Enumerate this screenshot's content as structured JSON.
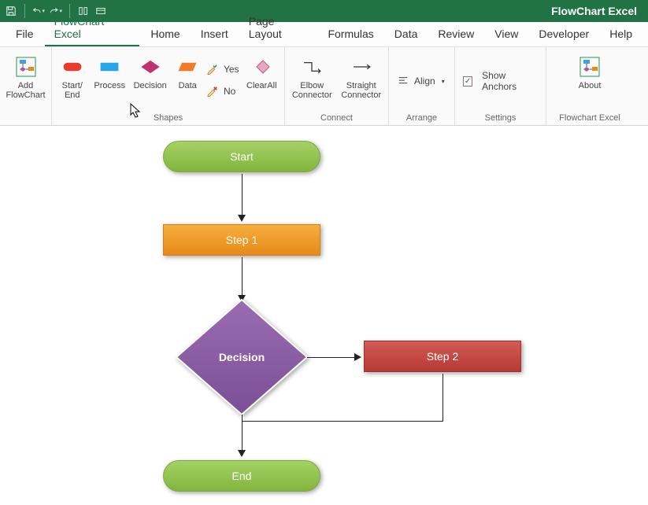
{
  "app": {
    "title": "FlowChart Excel"
  },
  "qat_icons": [
    "save-icon",
    "undo-icon",
    "redo-icon",
    "touch-icon",
    "minimize-ribbon-icon"
  ],
  "tabs": [
    {
      "label": "File",
      "active": false
    },
    {
      "label": "FlowChart Excel",
      "active": true
    },
    {
      "label": "Home",
      "active": false
    },
    {
      "label": "Insert",
      "active": false
    },
    {
      "label": "Page Layout",
      "active": false
    },
    {
      "label": "Formulas",
      "active": false
    },
    {
      "label": "Data",
      "active": false
    },
    {
      "label": "Review",
      "active": false
    },
    {
      "label": "View",
      "active": false
    },
    {
      "label": "Developer",
      "active": false
    },
    {
      "label": "Help",
      "active": false
    }
  ],
  "ribbon": {
    "groups": {
      "add": {
        "label": "",
        "button": "Add FlowChart"
      },
      "shapes": {
        "label": "Shapes",
        "buttons": [
          "Start/ End",
          "Process",
          "Decision",
          "Data",
          "Yes",
          "No",
          "ClearAll"
        ]
      },
      "connect": {
        "label": "Connect",
        "buttons": [
          "Elbow Connector",
          "Straight Connector"
        ]
      },
      "arrange": {
        "label": "Arrange",
        "align": "Align"
      },
      "settings": {
        "label": "Settings",
        "show_anchors": "Show Anchors"
      },
      "about": {
        "label": "Flowchart Excel",
        "button": "About"
      }
    }
  },
  "flow": {
    "start": "Start",
    "step1": "Step 1",
    "decision": "Decision",
    "step2": "Step 2",
    "end": "End"
  }
}
